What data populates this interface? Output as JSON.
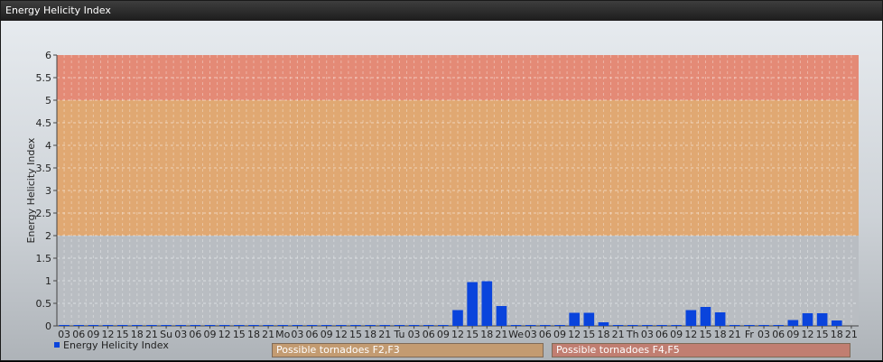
{
  "window": {
    "title": "Energy Helicity Index"
  },
  "legend": {
    "label": "Energy Helicity Index"
  },
  "zones": [
    {
      "label": "Possible tornadoes F2,F3",
      "color": "#c39b71"
    },
    {
      "label": "Possible tornadoes F4,F5",
      "color": "#c17e71"
    }
  ],
  "colors": {
    "bar": "#0a44dc",
    "band_low": "#b9bdc2",
    "band_mid": "#e0a872",
    "band_high": "#e48a76"
  },
  "chart_data": {
    "type": "bar",
    "ylabel": "Energy Helicity Index",
    "ylim": [
      0,
      6
    ],
    "yticks": [
      "0",
      "0.5",
      "1",
      "1.5",
      "2",
      "2.5",
      "3",
      "3.5",
      "4",
      "4.5",
      "5",
      "5.5",
      "6"
    ],
    "bands": [
      {
        "from": 0,
        "to": 2
      },
      {
        "from": 2,
        "to": 5
      },
      {
        "from": 5,
        "to": 6
      }
    ],
    "grid": true,
    "categories": [
      "03",
      "06",
      "09",
      "12",
      "15",
      "18",
      "21",
      "Su",
      "03",
      "06",
      "09",
      "12",
      "15",
      "18",
      "21",
      "Mo",
      "03",
      "06",
      "09",
      "12",
      "15",
      "18",
      "21",
      "Tu",
      "03",
      "06",
      "09",
      "12",
      "15",
      "18",
      "21",
      "We",
      "03",
      "06",
      "09",
      "12",
      "15",
      "18",
      "21",
      "Th",
      "03",
      "06",
      "09",
      "12",
      "15",
      "18",
      "21",
      "Fr",
      "03",
      "06",
      "09",
      "12",
      "15",
      "18",
      "21"
    ],
    "series": [
      {
        "values": [
          0.01,
          0.01,
          0.01,
          0.01,
          0.01,
          0.01,
          0.01,
          0.01,
          0.01,
          0.01,
          0.01,
          0.01,
          0.01,
          0.01,
          0.01,
          0.01,
          0.01,
          0.01,
          0.01,
          0.01,
          0.01,
          0.01,
          0.01,
          0.01,
          0.01,
          0.01,
          0.01,
          0.35,
          0.97,
          0.99,
          0.44,
          0.01,
          0.01,
          0.01,
          0.01,
          0.29,
          0.29,
          0.08,
          0.01,
          0.01,
          0.01,
          0.01,
          0.01,
          0.35,
          0.42,
          0.3,
          0.01,
          0.01,
          0.01,
          0.01,
          0.13,
          0.28,
          0.28,
          0.12
        ]
      }
    ]
  }
}
